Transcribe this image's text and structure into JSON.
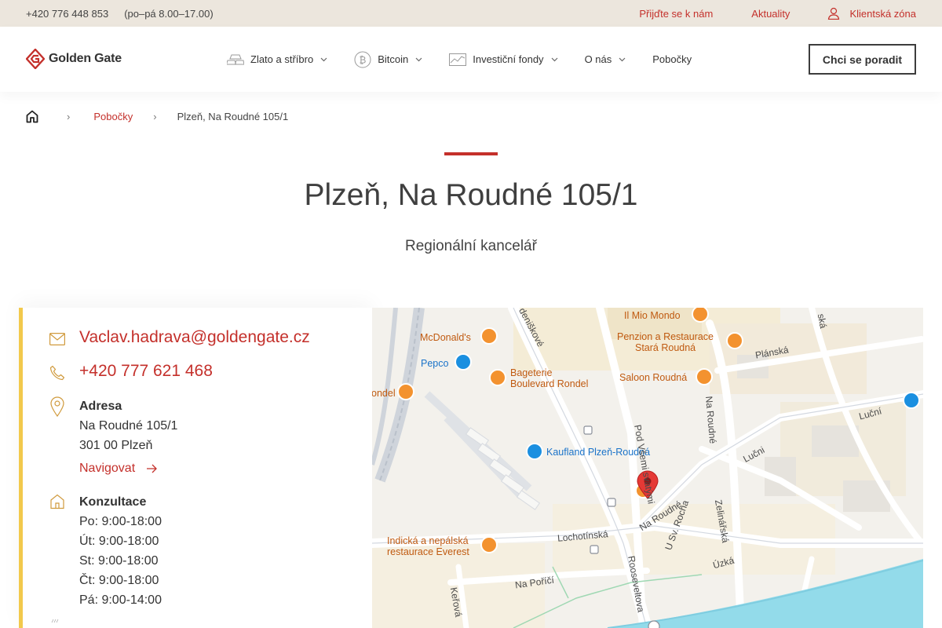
{
  "topbar": {
    "phone": "+420 776 448 853",
    "hours": "(po–pá 8.00–17.00)",
    "links": [
      "Přijďte se k nám",
      "Aktuality"
    ],
    "client_zone": "Klientská zóna"
  },
  "header": {
    "logo_text": "Golden Gate",
    "nav": [
      {
        "label": "Zlato a stříbro",
        "icon": "gold-bars-icon"
      },
      {
        "label": "Bitcoin",
        "icon": "bitcoin-icon"
      },
      {
        "label": "Investiční fondy",
        "icon": "chart-icon"
      },
      {
        "label": "O nás"
      },
      {
        "label": "Pobočky"
      }
    ],
    "cta": "Chci se poradit"
  },
  "breadcrumb": {
    "parent": "Pobočky",
    "current": "Plzeň, Na Roudné 105/1"
  },
  "page": {
    "title": "Plzeň, Na Roudné 105/1",
    "subtitle": "Regionální kancelář"
  },
  "contact": {
    "email": "Vaclav.hadrava@goldengate.cz",
    "phone": "+420 777 621 468",
    "address_heading": "Adresa",
    "address_line1": "Na Roudné 105/1",
    "address_line2": "301 00 Plzeň",
    "navigate": "Navigovat",
    "hours_heading": "Konzultace",
    "hours": [
      "Po: 9:00-18:00",
      "Út: 9:00-18:00",
      "St: 9:00-18:00",
      "Čt: 9:00-18:00",
      "Pá: 9:00-14:00"
    ]
  },
  "map": {
    "pois": [
      "Il Mio Mondo",
      "Penzion a Restaurace",
      "Stará Roudná",
      "McDonald's",
      "Pepco",
      "Bageterie",
      "Boulevard Rondel",
      "Saloon Roudná",
      "Rondel",
      "Kaufland Plzeň-Roudná",
      "Indická a nepálská",
      "restaurace Everest"
    ],
    "streets": [
      "deniškové",
      "Plánská",
      "Pod Všemi svatými",
      "Na Roudné",
      "Lučni",
      "Luční",
      "Lochotínská",
      "Na Roudné",
      "U Sv. Rocha",
      "Zelinářská",
      "Úzká",
      "Rooseveltova",
      "Keřová",
      "Na Poříčí",
      "ská"
    ]
  },
  "colors": {
    "accent": "#c4302b",
    "card_border": "#f2c94c",
    "topbar_bg": "#ece6dd"
  }
}
